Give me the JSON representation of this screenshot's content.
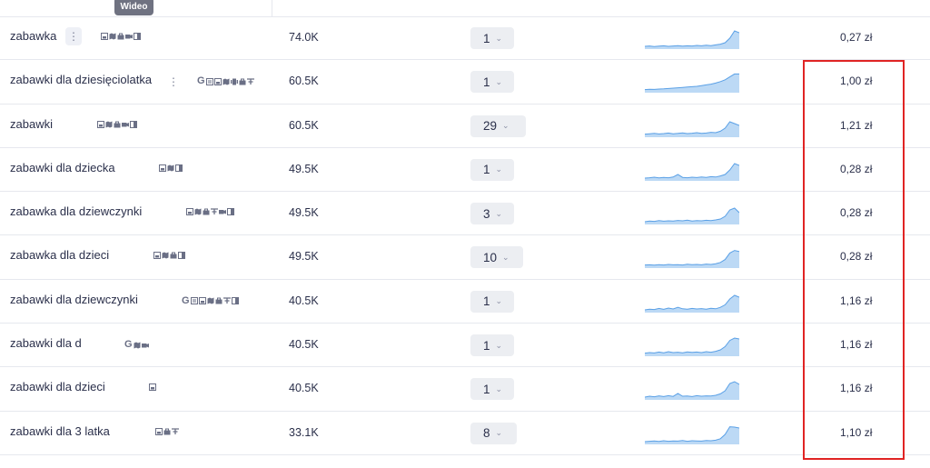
{
  "tooltip": {
    "label": "Wideo"
  },
  "rows": [
    {
      "keyword": "zabawka",
      "more": "⋮",
      "features": [
        "image-pack-icon",
        "map-pack-icon",
        "shopping-icon",
        "video-icon",
        "knowledge-panel-icon"
      ],
      "volume": "74.0K",
      "position": "1",
      "cpc": "0,27 zł",
      "trend": [
        0.1,
        0.12,
        0.09,
        0.11,
        0.13,
        0.1,
        0.12,
        0.14,
        0.11,
        0.13,
        0.12,
        0.15,
        0.13,
        0.16,
        0.14,
        0.18,
        0.22,
        0.3,
        0.55,
        0.95,
        0.85
      ]
    },
    {
      "keyword": "zabawki dla dziesięciolatka",
      "more": "⋮",
      "features": [
        "google-icon",
        "sitelinks-icon",
        "image-pack-icon",
        "map-pack-icon",
        "carousel-icon",
        "shopping-icon",
        "ads-icon"
      ],
      "volume": "60.5K",
      "position": "1",
      "cpc": "1,00 zł",
      "trend": [
        0.12,
        0.14,
        0.13,
        0.15,
        0.16,
        0.18,
        0.2,
        0.22,
        0.24,
        0.26,
        0.28,
        0.3,
        0.34,
        0.38,
        0.42,
        0.48,
        0.56,
        0.66,
        0.82,
        0.98,
        0.98
      ]
    },
    {
      "keyword": "zabawki",
      "more": "",
      "features": [
        "image-pack-icon",
        "map-pack-icon",
        "shopping-icon",
        "video-icon",
        "knowledge-panel-icon"
      ],
      "volume": "60.5K",
      "position": "29",
      "cpc": "1,21 zł",
      "trend": [
        0.12,
        0.14,
        0.16,
        0.13,
        0.15,
        0.18,
        0.14,
        0.16,
        0.19,
        0.15,
        0.17,
        0.2,
        0.16,
        0.18,
        0.22,
        0.2,
        0.28,
        0.45,
        0.8,
        0.7,
        0.6
      ]
    },
    {
      "keyword": "zabawki dla dziecka",
      "more": "",
      "features": [
        "image-pack-icon",
        "map-pack-icon",
        "knowledge-panel-icon"
      ],
      "volume": "49.5K",
      "position": "1",
      "cpc": "0,28 zł",
      "trend": [
        0.1,
        0.12,
        0.15,
        0.11,
        0.14,
        0.12,
        0.16,
        0.3,
        0.14,
        0.12,
        0.15,
        0.13,
        0.16,
        0.14,
        0.18,
        0.16,
        0.22,
        0.3,
        0.55,
        0.9,
        0.8
      ]
    },
    {
      "keyword": "zabawka dla dziewczynki",
      "more": "",
      "features": [
        "image-pack-icon",
        "map-pack-icon",
        "shopping-icon",
        "ads-icon",
        "video-icon",
        "knowledge-panel-icon"
      ],
      "volume": "49.5K",
      "position": "3",
      "cpc": "0,28 zł",
      "trend": [
        0.1,
        0.14,
        0.12,
        0.16,
        0.13,
        0.15,
        0.14,
        0.17,
        0.15,
        0.19,
        0.14,
        0.16,
        0.15,
        0.18,
        0.16,
        0.2,
        0.25,
        0.4,
        0.75,
        0.85,
        0.6
      ]
    },
    {
      "keyword": "zabawka dla dzieci",
      "more": "",
      "features": [
        "image-pack-icon",
        "map-pack-icon",
        "shopping-icon",
        "knowledge-panel-icon"
      ],
      "volume": "49.5K",
      "position": "10",
      "cpc": "0,28 zł",
      "trend": [
        0.12,
        0.13,
        0.11,
        0.14,
        0.12,
        0.15,
        0.13,
        0.14,
        0.12,
        0.16,
        0.14,
        0.15,
        0.13,
        0.17,
        0.15,
        0.19,
        0.26,
        0.42,
        0.78,
        0.92,
        0.86
      ]
    },
    {
      "keyword": "zabawki dla dziewczynki",
      "more": "",
      "features": [
        "google-icon",
        "sitelinks-icon",
        "image-pack-icon",
        "map-pack-icon",
        "shopping-icon",
        "ads-icon",
        "knowledge-panel-icon"
      ],
      "volume": "40.5K",
      "position": "1",
      "cpc": "1,16 zł",
      "trend": [
        0.1,
        0.14,
        0.12,
        0.18,
        0.13,
        0.2,
        0.15,
        0.24,
        0.16,
        0.14,
        0.18,
        0.15,
        0.17,
        0.14,
        0.19,
        0.16,
        0.24,
        0.38,
        0.7,
        0.9,
        0.8
      ]
    },
    {
      "keyword": "zabawki dla d",
      "more": "",
      "features": [
        "google-icon",
        "map-pack-icon",
        "video-icon"
      ],
      "volume": "40.5K",
      "position": "1",
      "cpc": "1,16 zł",
      "trend": [
        0.12,
        0.15,
        0.13,
        0.18,
        0.14,
        0.2,
        0.15,
        0.17,
        0.14,
        0.19,
        0.16,
        0.18,
        0.15,
        0.2,
        0.17,
        0.22,
        0.3,
        0.48,
        0.82,
        0.95,
        0.9
      ]
    },
    {
      "keyword": "zabawki dla dzieci",
      "more": "",
      "features": [
        "image-pack-icon"
      ],
      "volume": "40.5K",
      "position": "1",
      "cpc": "1,16 zł",
      "trend": [
        0.1,
        0.15,
        0.12,
        0.17,
        0.13,
        0.18,
        0.14,
        0.3,
        0.15,
        0.16,
        0.13,
        0.18,
        0.15,
        0.17,
        0.16,
        0.2,
        0.28,
        0.45,
        0.85,
        0.95,
        0.8
      ]
    },
    {
      "keyword": "zabawki dla 3 latka",
      "more": "",
      "features": [
        "image-pack-icon",
        "shopping-icon",
        "ads-icon"
      ],
      "volume": "33.1K",
      "position": "8",
      "cpc": "1,10 zł",
      "trend": [
        0.1,
        0.12,
        0.14,
        0.11,
        0.15,
        0.12,
        0.14,
        0.13,
        0.16,
        0.12,
        0.15,
        0.14,
        0.13,
        0.16,
        0.15,
        0.18,
        0.26,
        0.5,
        0.92,
        0.9,
        0.85
      ]
    }
  ],
  "colors": {
    "highlight": "#e02424",
    "trend_fill": "#bcd9f5",
    "trend_line": "#5aa0e6",
    "badge_bg": "#eceef2",
    "text": "#2a2f4a"
  }
}
